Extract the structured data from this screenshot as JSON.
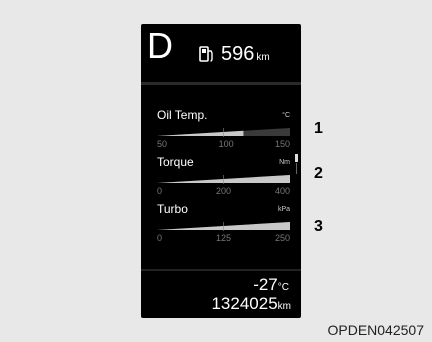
{
  "cluster": {
    "gear": "D",
    "fuel_icon": "fuel-pump-icon",
    "range_value": "596",
    "range_unit": "km",
    "gauges": [
      {
        "name": "Oil Temp.",
        "unit": "°C",
        "ticks": [
          "50",
          "100",
          "150"
        ],
        "level": 0.65
      },
      {
        "name": "Torque",
        "unit": "Nm",
        "ticks": [
          "0",
          "200",
          "400"
        ],
        "level": 1.0
      },
      {
        "name": "Turbo",
        "unit": "kPa",
        "ticks": [
          "0",
          "125",
          "250"
        ],
        "level": 1.0
      }
    ],
    "outside_temp_value": "-27",
    "outside_temp_unit": "°C",
    "odometer_value": "1324025",
    "odometer_unit": "km"
  },
  "callouts": [
    "1",
    "2",
    "3"
  ],
  "image_code": "OPDEN042507",
  "colors": {
    "background": "#e8e8e8",
    "display": "#000000",
    "text": "#ffffff",
    "gauge_fill": "#c8c8c8"
  }
}
